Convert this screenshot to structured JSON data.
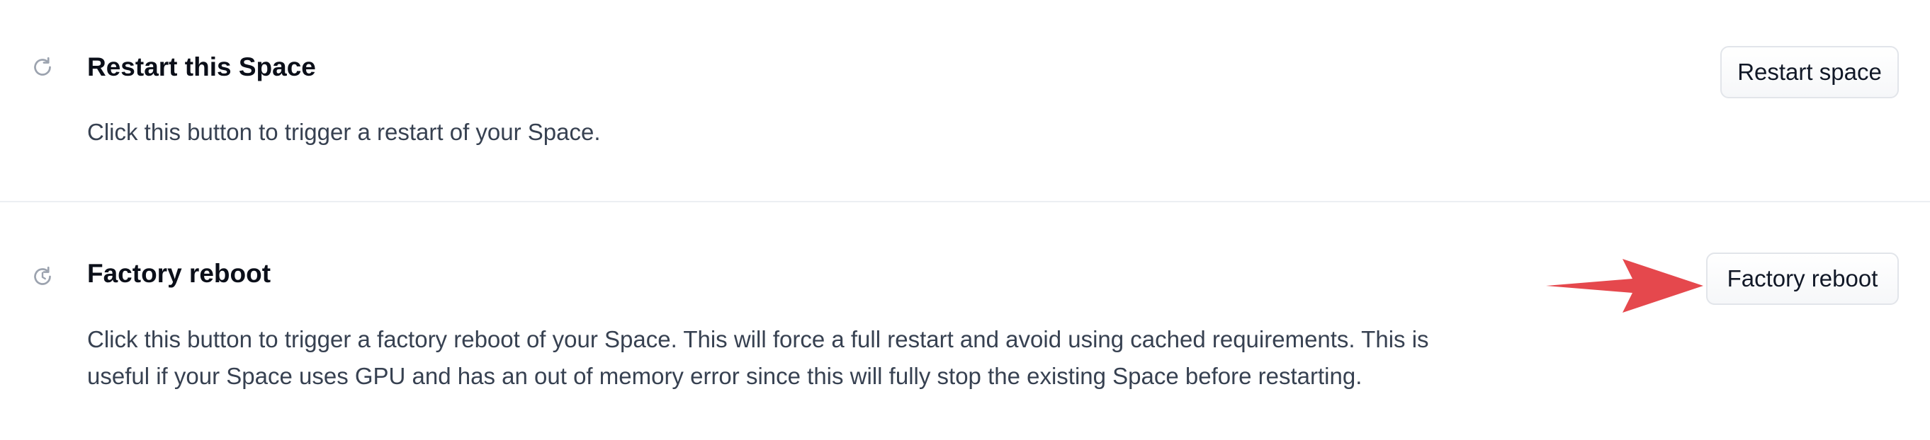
{
  "restart_section": {
    "icon": "refresh-icon",
    "title": "Restart this Space",
    "description": "Click this button to trigger a restart of your Space.",
    "button_label": "Restart space"
  },
  "factory_section": {
    "icon": "factory-reboot-icon",
    "title": "Factory reboot",
    "description": "Click this button to trigger a factory reboot of your Space. This will force a full restart and avoid using cached requirements. This is useful if your Space uses GPU and has an out of memory error since this will fully stop the existing Space before restarting.",
    "button_label": "Factory reboot"
  },
  "annotation": {
    "icon": "red-arrow-pointer",
    "color": "#e5484d"
  },
  "colors": {
    "icon_gray": "#9ca3af",
    "divider": "#eceff3",
    "button_border": "#e2e5ea"
  }
}
